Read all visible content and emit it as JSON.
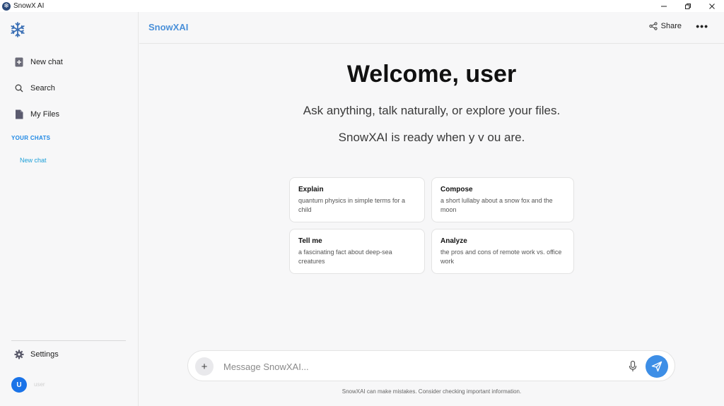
{
  "window": {
    "title": "SnowX AI"
  },
  "sidebar": {
    "items": [
      {
        "label": "New chat",
        "icon": "new-chat-icon"
      },
      {
        "label": "Search",
        "icon": "search-icon"
      },
      {
        "label": "My Files",
        "icon": "file-icon"
      }
    ],
    "section_label": "YOUR CHATS",
    "chats": [
      {
        "label": "New chat"
      }
    ],
    "settings_label": "Settings",
    "user_initial": "U",
    "user_name": "user"
  },
  "header": {
    "brand": "SnowXAI",
    "share_label": "Share",
    "more_label": "•••"
  },
  "main": {
    "welcome": "Welcome, user",
    "subtitle": "Ask anything, talk naturally, or explore your files.",
    "ready": "SnowXAI is ready when y v ou are.",
    "cards": [
      {
        "title": "Explain",
        "desc": "quantum physics in simple terms for a child"
      },
      {
        "title": "Compose",
        "desc": "a short lullaby about a snow fox and the moon"
      },
      {
        "title": "Tell me",
        "desc": "a fascinating fact about deep-sea creatures"
      },
      {
        "title": "Analyze",
        "desc": "the pros and cons of remote work vs. office work"
      }
    ]
  },
  "composer": {
    "placeholder": "Message SnowXAI...",
    "plus": "+"
  },
  "footer": {
    "disclaimer": "SnowXAI can make mistakes. Consider checking important information."
  },
  "colors": {
    "accent": "#3d8ee6",
    "brand": "#4a90d9",
    "chat_link": "#1ea0d8"
  }
}
